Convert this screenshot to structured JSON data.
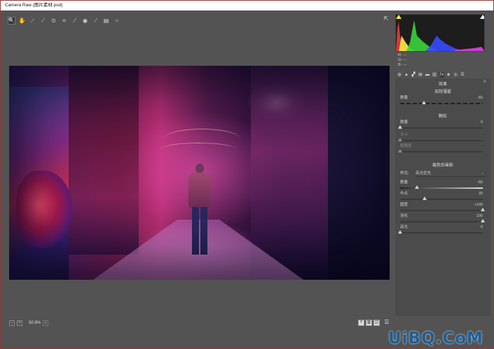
{
  "window": {
    "title": "Camera Raw (图片素材.psd)"
  },
  "toolbar": {
    "tools": [
      {
        "icon": "zoom-icon",
        "glyph": "🔍"
      },
      {
        "icon": "hand-icon",
        "glyph": "✋"
      },
      {
        "icon": "white-balance-icon",
        "glyph": "⟋"
      },
      {
        "icon": "color-sampler-icon",
        "glyph": "⟋"
      },
      {
        "icon": "targeted-adjust-icon",
        "glyph": "⊙"
      },
      {
        "icon": "crop-icon",
        "glyph": "⌗"
      },
      {
        "icon": "spot-removal-icon",
        "glyph": "⟋"
      },
      {
        "icon": "red-eye-icon",
        "glyph": "◉"
      },
      {
        "icon": "adjustment-brush-icon",
        "glyph": "⟋"
      },
      {
        "icon": "graduated-filter-icon",
        "glyph": "▤"
      },
      {
        "icon": "radial-filter-icon",
        "glyph": "○"
      }
    ],
    "open_preferences_glyph": "⇱"
  },
  "histogram": {
    "readout": {
      "r": "R: ---",
      "g": "G: ---",
      "b": "B: ---"
    }
  },
  "panel_tabs": [
    "◍",
    "▲",
    "▞",
    "▤",
    "▬",
    "▥",
    "ƒx",
    "◈",
    "◎",
    "☰"
  ],
  "panel": {
    "title": "效果",
    "menu_glyph": "≡",
    "dehaze": {
      "title": "去除薄雾",
      "amount_label": "数量",
      "amount_value": "-60"
    },
    "grain": {
      "title": "颗粒",
      "amount_label": "数量",
      "amount_value": "0",
      "size_label": "大小",
      "roughness_label": "粗糙度"
    },
    "vignette": {
      "title": "裁剪后晕影",
      "style_label": "样式:",
      "style_value": "高光优先",
      "amount_label": "数量",
      "amount_value": "-60",
      "midpoint_label": "中点",
      "midpoint_value": "30",
      "roundness_label": "圆度",
      "roundness_value": "+100",
      "feather_label": "羽化",
      "feather_value": "100",
      "highlights_label": "高光",
      "highlights_value": "0"
    }
  },
  "status": {
    "zoom_minus": "−",
    "zoom_plus": "+",
    "zoom_level": "50.9%",
    "zoom_dropdown": "▾",
    "view_y": "Y",
    "view_compare": "▥",
    "view_toggle": "◫",
    "settings_glyph": "☰"
  },
  "watermark": {
    "text": "UiBQ.CoM"
  },
  "colors": {
    "panel_bg": "#4b4b4b",
    "window_bg": "#535353",
    "watermark": "#1d5f95"
  }
}
